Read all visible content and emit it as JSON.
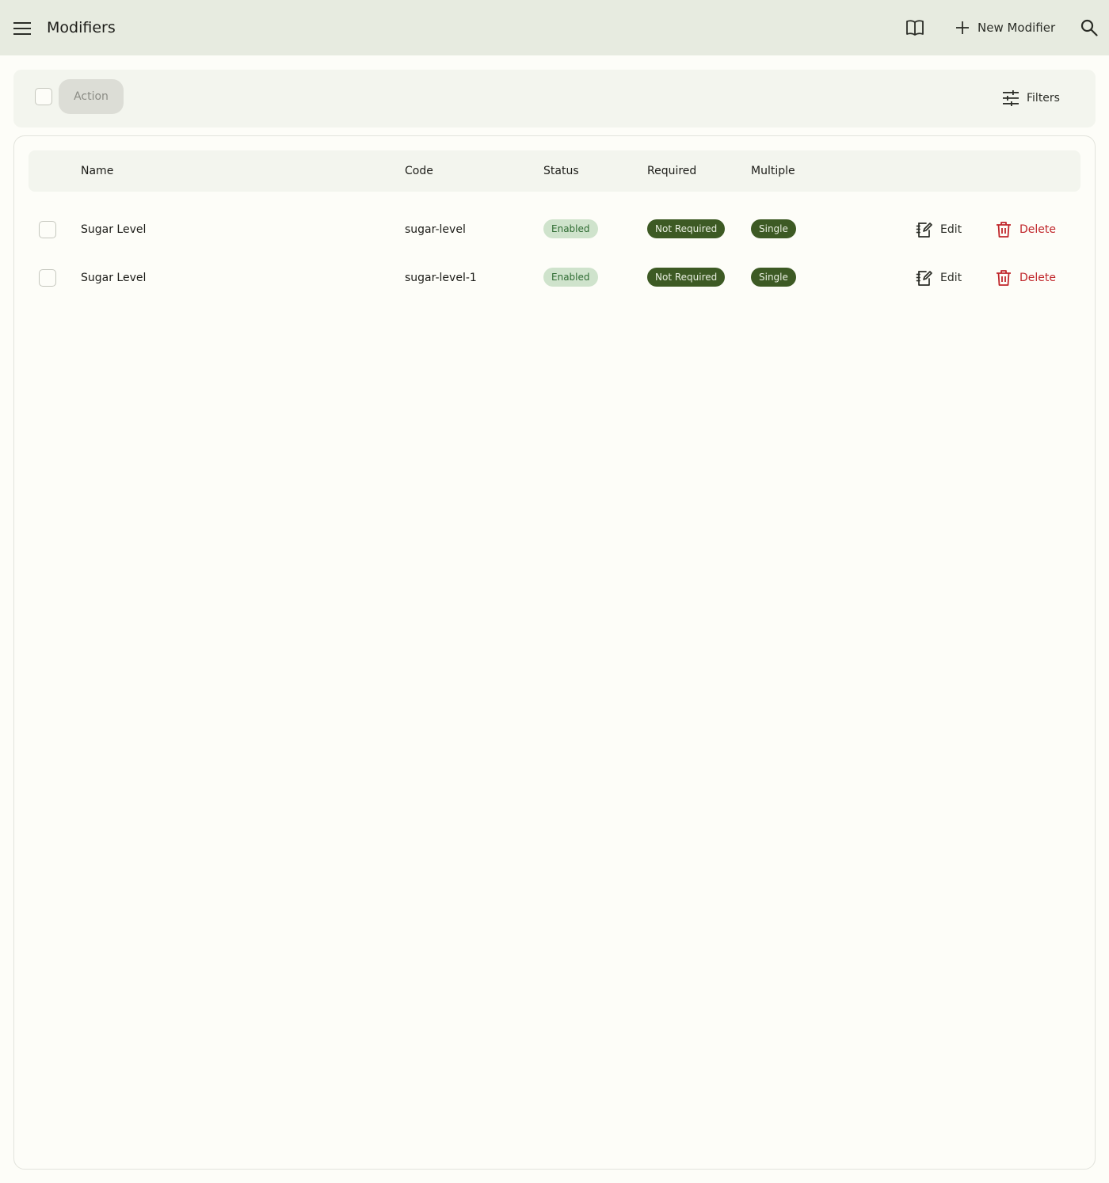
{
  "appbar": {
    "title": "Modifiers",
    "new_label": "New Modifier",
    "icons": {
      "menu": "menu-icon",
      "docs": "book-open-icon",
      "add": "plus-icon",
      "search": "search-icon"
    }
  },
  "toolbar": {
    "action_label": "Action",
    "filters_label": "Filters",
    "filters_icon": "tune-icon"
  },
  "table": {
    "columns": {
      "name": "Name",
      "code": "Code",
      "status": "Status",
      "required": "Required",
      "multiple": "Multiple"
    },
    "rows": [
      {
        "name": "Sugar Level",
        "code": "sugar-level",
        "status": "Enabled",
        "required": "Not Required",
        "multiple": "Single",
        "edit_label": "Edit",
        "delete_label": "Delete"
      },
      {
        "name": "Sugar Level",
        "code": "sugar-level-1",
        "status": "Enabled",
        "required": "Not Required",
        "multiple": "Single",
        "edit_label": "Edit",
        "delete_label": "Delete"
      }
    ]
  },
  "colors": {
    "appbar_bg": "#e7ebe0",
    "enabled_chip_bg": "#cfe3cc",
    "enabled_chip_text": "#2e6b32",
    "dark_chip_bg": "#3d5a24",
    "delete": "#c0262b"
  }
}
